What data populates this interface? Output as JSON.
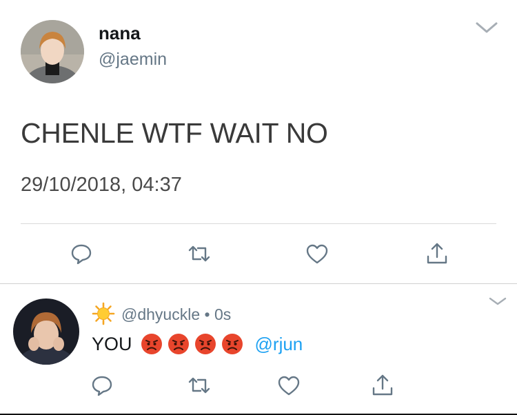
{
  "tweet": {
    "name": "nana",
    "handle": "@jaemin",
    "text": "CHENLE WTF WAIT NO",
    "timestamp": "29/10/2018, 04:37",
    "actions": [
      "reply-icon",
      "retweet-icon",
      "like-icon",
      "share-icon"
    ]
  },
  "reply": {
    "handle_line": "@dhyuckle • 0s",
    "text": "YOU",
    "emoji": [
      "angry-face",
      "angry-face",
      "angry-face",
      "angry-face"
    ],
    "mention": "@rjun",
    "actions": [
      "reply-icon",
      "retweet-icon",
      "like-icon",
      "share-icon"
    ]
  },
  "colors": {
    "link": "#1da1f2",
    "secondary": "#657786",
    "icon": "#657786",
    "angry": "#e8452c"
  }
}
